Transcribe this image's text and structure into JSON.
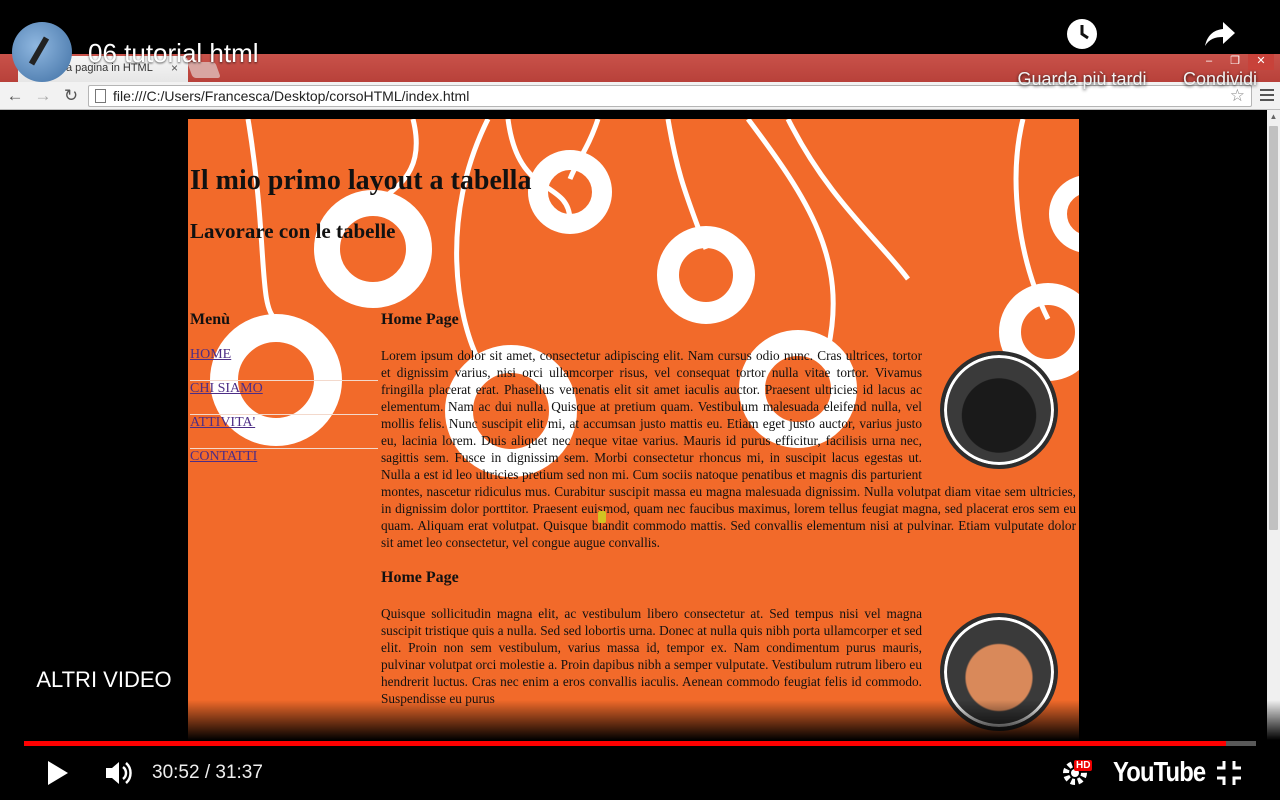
{
  "browser": {
    "tab_title": "a pagina in HTML",
    "tab_close": "×",
    "url": "file:///C:/Users/Francesca/Desktop/corsoHTML/index.html",
    "window_controls": [
      "–",
      "❐",
      "✕"
    ]
  },
  "page": {
    "heading": "Il mio primo layout a tabella",
    "subheading": "Lavorare con le tabelle",
    "menu": {
      "title": "Menù",
      "items": [
        "HOME",
        "CHI SIAMO",
        "ATTIVITA'",
        "CONTATTI"
      ]
    },
    "sections": [
      {
        "title": "Home Page",
        "text": "Lorem ipsum dolor sit amet, consectetur adipiscing elit. Nam cursus odio nunc. Cras ultrices, tortor et dignissim varius, nisi orci ullamcorper risus, vel consequat tortor nulla vitae tortor. Vivamus fringilla placerat erat. Phasellus venenatis elit sit amet iaculis auctor. Praesent ultricies id lacus ac elementum. Nam ac dui nulla. Quisque at pretium quam. Vestibulum malesuada eleifend nulla, vel mollis felis. Nunc suscipit elit mi, at accumsan justo mattis eu. Etiam eget justo auctor, varius justo eu, lacinia lorem. Duis aliquet nec neque vitae varius. Mauris id purus efficitur, facilisis urna nec, sagittis sem. Fusce in dignissim sem. Morbi consectetur rhoncus mi, in suscipit lacus egestas ut. Nulla a est id leo ultricies pretium sed non mi. Cum sociis natoque penatibus et magnis dis parturient montes, nascetur ridiculus mus. Curabitur suscipit massa eu magna malesuada dignissim. Nulla volutpat diam vitae sem ultricies, in dignissim dolor porttitor. Praesent euismod, quam nec faucibus maximus, lorem tellus feugiat magna, sed placerat eros sem eu quam. Aliquam erat volutpat. Quisque blandit commodo mattis. Sed convallis elementum nisi at pulvinar. Etiam vulputate dolor sit amet leo consectetur, vel congue augue convallis."
      },
      {
        "title": "Home Page",
        "text": "Quisque sollicitudin magna elit, ac vestibulum libero consectetur at. Sed tempus nisi vel magna suscipit tristique quis a nulla. Sed sed lobortis urna. Donec at nulla quis nibh porta ullamcorper et sed elit. Proin non sem vestibulum, varius massa id, tempor ex. Nam condimentum purus mauris, pulvinar volutpat orci molestie a. Proin dapibus nibh a semper vulputate. Vestibulum rutrum libero eu hendrerit luctus. Cras nec enim a eros convallis iaculis. Aenean commodo feugiat felis id commodo. Suspendisse eu purus"
      }
    ]
  },
  "youtube": {
    "video_title": "06 tutorial html",
    "watch_later": "Guarda più tardi",
    "share": "Condividi",
    "more_videos": "ALTRI VIDEO",
    "time": "30:52 / 31:37",
    "hd": "HD",
    "logo": "YouTube",
    "progress_fraction": 0.976
  },
  "icons": {
    "back": "back-arrow-icon",
    "forward": "forward-arrow-icon",
    "reload": "reload-icon",
    "star": "bookmark-star-icon",
    "menu": "chrome-menu-icon",
    "play": "play-icon",
    "volume": "volume-icon",
    "settings": "settings-gear-icon",
    "exit_fullscreen": "exit-fullscreen-icon",
    "clock": "clock-icon",
    "share": "share-arrow-icon"
  },
  "colors": {
    "page_background": "#f26a2a",
    "link": "#4d2d86",
    "progress_played": "#ff0000",
    "tabbar": "#c9524a"
  }
}
